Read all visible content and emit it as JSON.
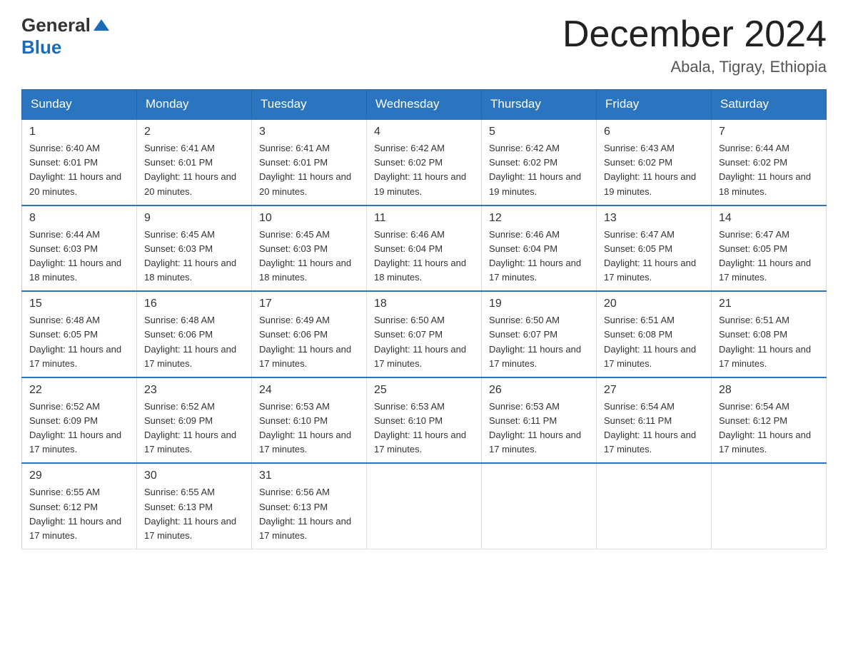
{
  "logo": {
    "general": "General",
    "blue": "Blue"
  },
  "title": "December 2024",
  "location": "Abala, Tigray, Ethiopia",
  "days_of_week": [
    "Sunday",
    "Monday",
    "Tuesday",
    "Wednesday",
    "Thursday",
    "Friday",
    "Saturday"
  ],
  "weeks": [
    [
      {
        "day": "1",
        "sunrise": "6:40 AM",
        "sunset": "6:01 PM",
        "daylight": "11 hours and 20 minutes."
      },
      {
        "day": "2",
        "sunrise": "6:41 AM",
        "sunset": "6:01 PM",
        "daylight": "11 hours and 20 minutes."
      },
      {
        "day": "3",
        "sunrise": "6:41 AM",
        "sunset": "6:01 PM",
        "daylight": "11 hours and 20 minutes."
      },
      {
        "day": "4",
        "sunrise": "6:42 AM",
        "sunset": "6:02 PM",
        "daylight": "11 hours and 19 minutes."
      },
      {
        "day": "5",
        "sunrise": "6:42 AM",
        "sunset": "6:02 PM",
        "daylight": "11 hours and 19 minutes."
      },
      {
        "day": "6",
        "sunrise": "6:43 AM",
        "sunset": "6:02 PM",
        "daylight": "11 hours and 19 minutes."
      },
      {
        "day": "7",
        "sunrise": "6:44 AM",
        "sunset": "6:02 PM",
        "daylight": "11 hours and 18 minutes."
      }
    ],
    [
      {
        "day": "8",
        "sunrise": "6:44 AM",
        "sunset": "6:03 PM",
        "daylight": "11 hours and 18 minutes."
      },
      {
        "day": "9",
        "sunrise": "6:45 AM",
        "sunset": "6:03 PM",
        "daylight": "11 hours and 18 minutes."
      },
      {
        "day": "10",
        "sunrise": "6:45 AM",
        "sunset": "6:03 PM",
        "daylight": "11 hours and 18 minutes."
      },
      {
        "day": "11",
        "sunrise": "6:46 AM",
        "sunset": "6:04 PM",
        "daylight": "11 hours and 18 minutes."
      },
      {
        "day": "12",
        "sunrise": "6:46 AM",
        "sunset": "6:04 PM",
        "daylight": "11 hours and 17 minutes."
      },
      {
        "day": "13",
        "sunrise": "6:47 AM",
        "sunset": "6:05 PM",
        "daylight": "11 hours and 17 minutes."
      },
      {
        "day": "14",
        "sunrise": "6:47 AM",
        "sunset": "6:05 PM",
        "daylight": "11 hours and 17 minutes."
      }
    ],
    [
      {
        "day": "15",
        "sunrise": "6:48 AM",
        "sunset": "6:05 PM",
        "daylight": "11 hours and 17 minutes."
      },
      {
        "day": "16",
        "sunrise": "6:48 AM",
        "sunset": "6:06 PM",
        "daylight": "11 hours and 17 minutes."
      },
      {
        "day": "17",
        "sunrise": "6:49 AM",
        "sunset": "6:06 PM",
        "daylight": "11 hours and 17 minutes."
      },
      {
        "day": "18",
        "sunrise": "6:50 AM",
        "sunset": "6:07 PM",
        "daylight": "11 hours and 17 minutes."
      },
      {
        "day": "19",
        "sunrise": "6:50 AM",
        "sunset": "6:07 PM",
        "daylight": "11 hours and 17 minutes."
      },
      {
        "day": "20",
        "sunrise": "6:51 AM",
        "sunset": "6:08 PM",
        "daylight": "11 hours and 17 minutes."
      },
      {
        "day": "21",
        "sunrise": "6:51 AM",
        "sunset": "6:08 PM",
        "daylight": "11 hours and 17 minutes."
      }
    ],
    [
      {
        "day": "22",
        "sunrise": "6:52 AM",
        "sunset": "6:09 PM",
        "daylight": "11 hours and 17 minutes."
      },
      {
        "day": "23",
        "sunrise": "6:52 AM",
        "sunset": "6:09 PM",
        "daylight": "11 hours and 17 minutes."
      },
      {
        "day": "24",
        "sunrise": "6:53 AM",
        "sunset": "6:10 PM",
        "daylight": "11 hours and 17 minutes."
      },
      {
        "day": "25",
        "sunrise": "6:53 AM",
        "sunset": "6:10 PM",
        "daylight": "11 hours and 17 minutes."
      },
      {
        "day": "26",
        "sunrise": "6:53 AM",
        "sunset": "6:11 PM",
        "daylight": "11 hours and 17 minutes."
      },
      {
        "day": "27",
        "sunrise": "6:54 AM",
        "sunset": "6:11 PM",
        "daylight": "11 hours and 17 minutes."
      },
      {
        "day": "28",
        "sunrise": "6:54 AM",
        "sunset": "6:12 PM",
        "daylight": "11 hours and 17 minutes."
      }
    ],
    [
      {
        "day": "29",
        "sunrise": "6:55 AM",
        "sunset": "6:12 PM",
        "daylight": "11 hours and 17 minutes."
      },
      {
        "day": "30",
        "sunrise": "6:55 AM",
        "sunset": "6:13 PM",
        "daylight": "11 hours and 17 minutes."
      },
      {
        "day": "31",
        "sunrise": "6:56 AM",
        "sunset": "6:13 PM",
        "daylight": "11 hours and 17 minutes."
      },
      null,
      null,
      null,
      null
    ]
  ]
}
